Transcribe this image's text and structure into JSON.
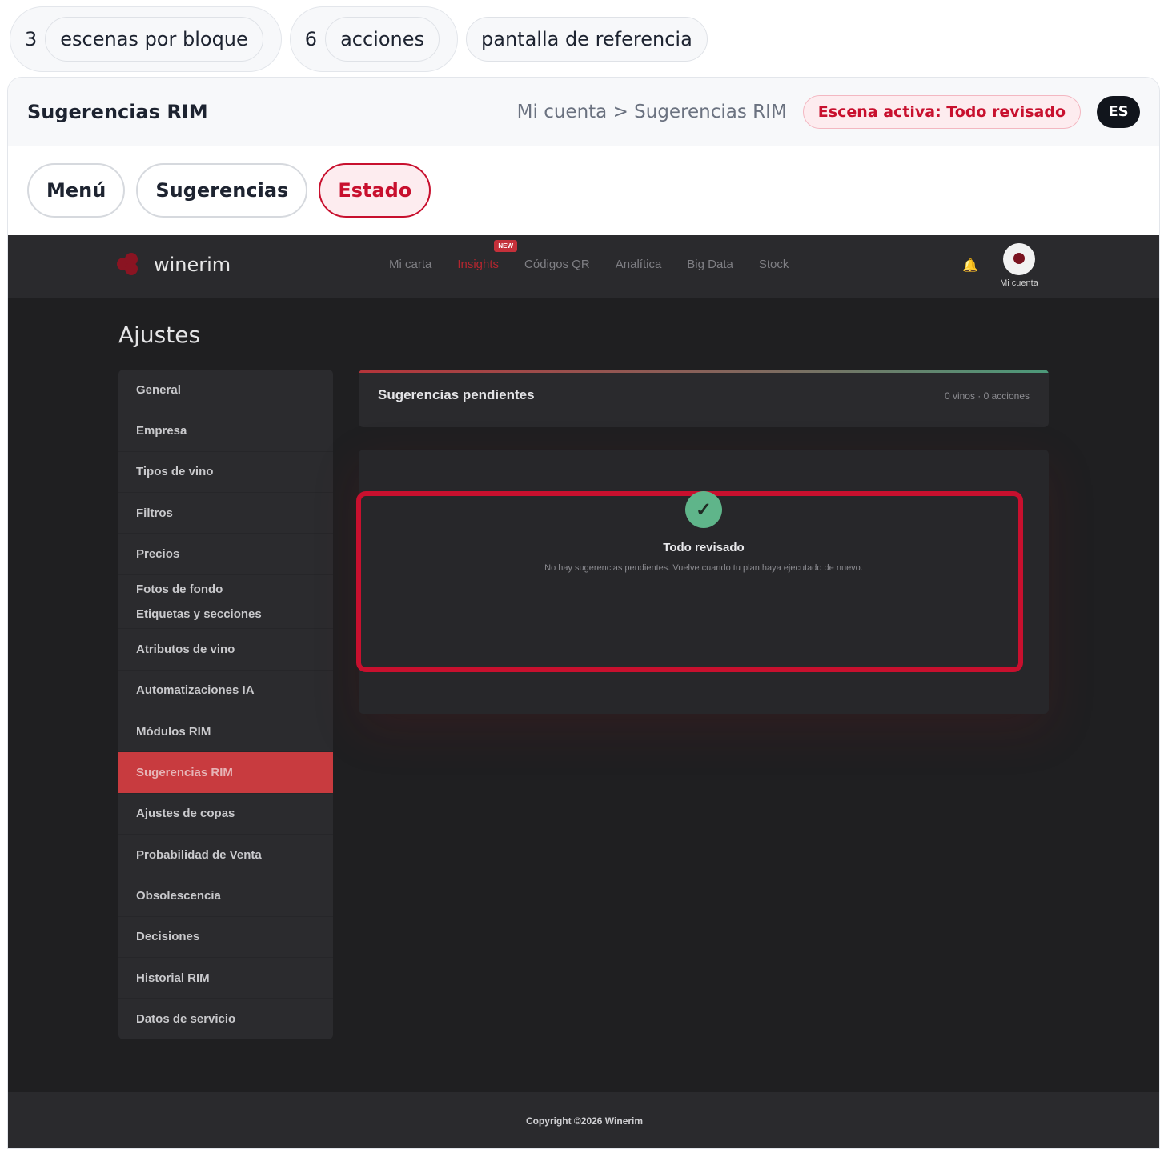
{
  "chips": {
    "scenes_count": "3",
    "scenes_label": "escenas por bloque",
    "actions_count": "6",
    "actions_label": "acciones",
    "reference_label": "pantalla de referencia"
  },
  "header": {
    "title": "Sugerencias RIM",
    "breadcrumb": "Mi cuenta > Sugerencias RIM",
    "active_scene": "Escena activa: Todo revisado",
    "language": "ES"
  },
  "tabs": [
    {
      "label": "Menú",
      "active": false
    },
    {
      "label": "Sugerencias",
      "active": false
    },
    {
      "label": "Estado",
      "active": true
    }
  ],
  "app": {
    "logo": "winerim",
    "nav": [
      {
        "label": "Mi carta"
      },
      {
        "label": "Insights",
        "badge": "NEW",
        "active": true
      },
      {
        "label": "Códigos QR"
      },
      {
        "label": "Analítica"
      },
      {
        "label": "Big Data"
      },
      {
        "label": "Stock"
      }
    ],
    "account_label": "Mi cuenta",
    "page_title": "Ajustes",
    "sidebar": [
      {
        "label": "General"
      },
      {
        "label": "Empresa"
      },
      {
        "label": "Tipos de vino"
      },
      {
        "label": "Filtros"
      },
      {
        "label": "Precios"
      },
      {
        "label": "Fotos de fondo"
      },
      {
        "label": "Etiquetas y secciones"
      },
      {
        "label": "Atributos de vino"
      },
      {
        "label": "Automatizaciones IA"
      },
      {
        "label": "Módulos RIM"
      },
      {
        "label": "Sugerencias RIM",
        "active": true
      },
      {
        "label": "Ajustes de copas"
      },
      {
        "label": "Probabilidad de Venta"
      },
      {
        "label": "Obsolescencia"
      },
      {
        "label": "Decisiones"
      },
      {
        "label": "Historial RIM"
      },
      {
        "label": "Datos de servicio"
      }
    ],
    "pending": {
      "title": "Sugerencias pendientes",
      "meta": "0 vinos · 0 acciones"
    },
    "empty_state": {
      "title": "Todo revisado",
      "subtitle": "No hay sugerencias pendientes. Vuelve cuando tu plan haya ejecutado de nuevo."
    },
    "footer": "Copyright ©2026 Winerim"
  },
  "colors": {
    "accent": "#c8102e",
    "success": "#5fb58a",
    "app_bg": "#1f1f21"
  }
}
